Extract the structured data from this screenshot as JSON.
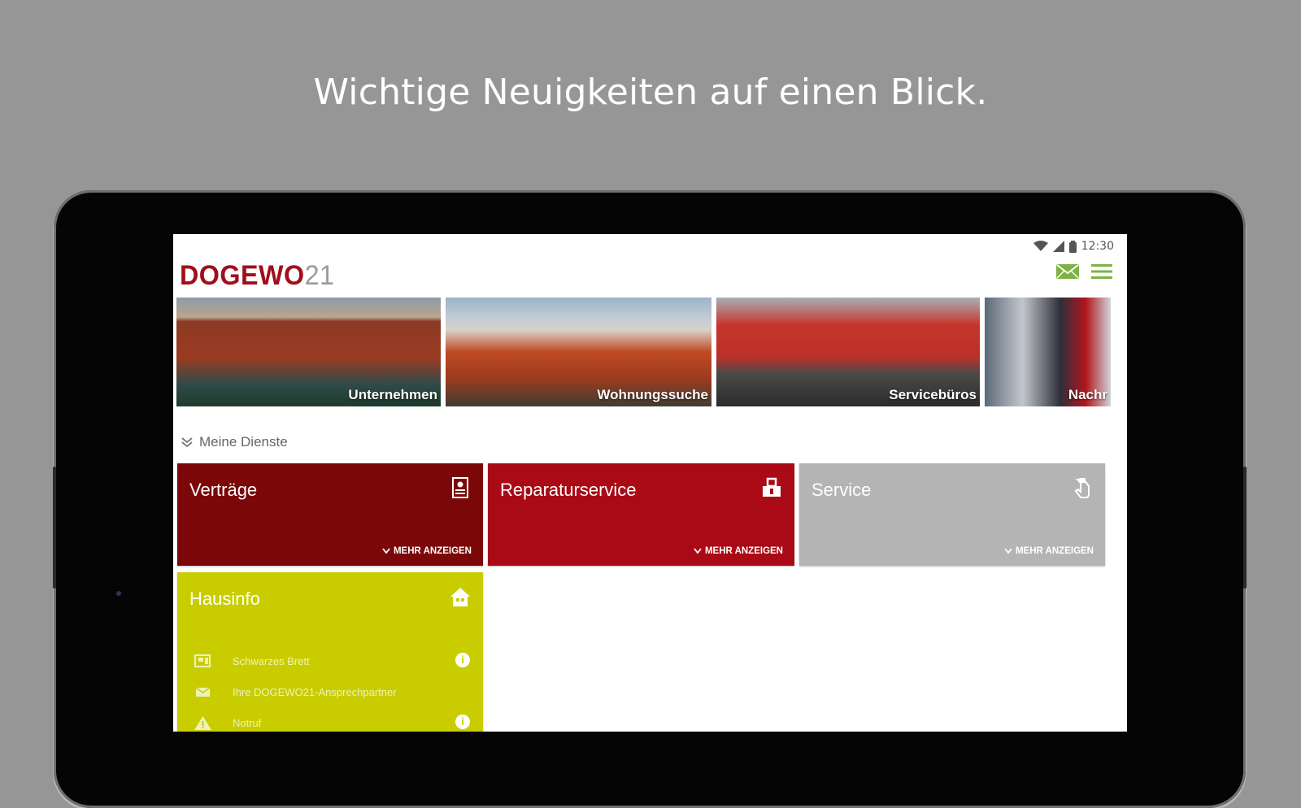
{
  "headline": "Wichtige Neuigkeiten auf einen Blick.",
  "status_bar": {
    "time": "12:30"
  },
  "app": {
    "logo_text": "DOGEWO",
    "logo_number": "21",
    "brand_color": "#a00f1b",
    "accent_green": "#7cb342"
  },
  "carousel": [
    {
      "label": "Unternehmen"
    },
    {
      "label": "Wohnungssuche"
    },
    {
      "label": "Servicebüros"
    },
    {
      "label": "Nachr"
    }
  ],
  "services": {
    "title": "Meine Dienste",
    "more_label": "MEHR ANZEIGEN",
    "tiles": [
      {
        "title": "Verträge",
        "color": "#7b0709",
        "icon": "contract-icon"
      },
      {
        "title": "Reparaturservice",
        "color": "#aa0a15",
        "icon": "tools-icon"
      },
      {
        "title": "Service",
        "color": "#b4b4b4",
        "icon": "hand-icon"
      }
    ],
    "hausinfo": {
      "title": "Hausinfo",
      "color": "#c9cd00",
      "items": [
        {
          "label": "Schwarzes Brett",
          "icon": "board-icon"
        },
        {
          "label": "Ihre DOGEWO21-Ansprechpartner",
          "icon": "mail-icon"
        },
        {
          "label": "Notruf",
          "icon": "warning-icon"
        }
      ]
    }
  }
}
